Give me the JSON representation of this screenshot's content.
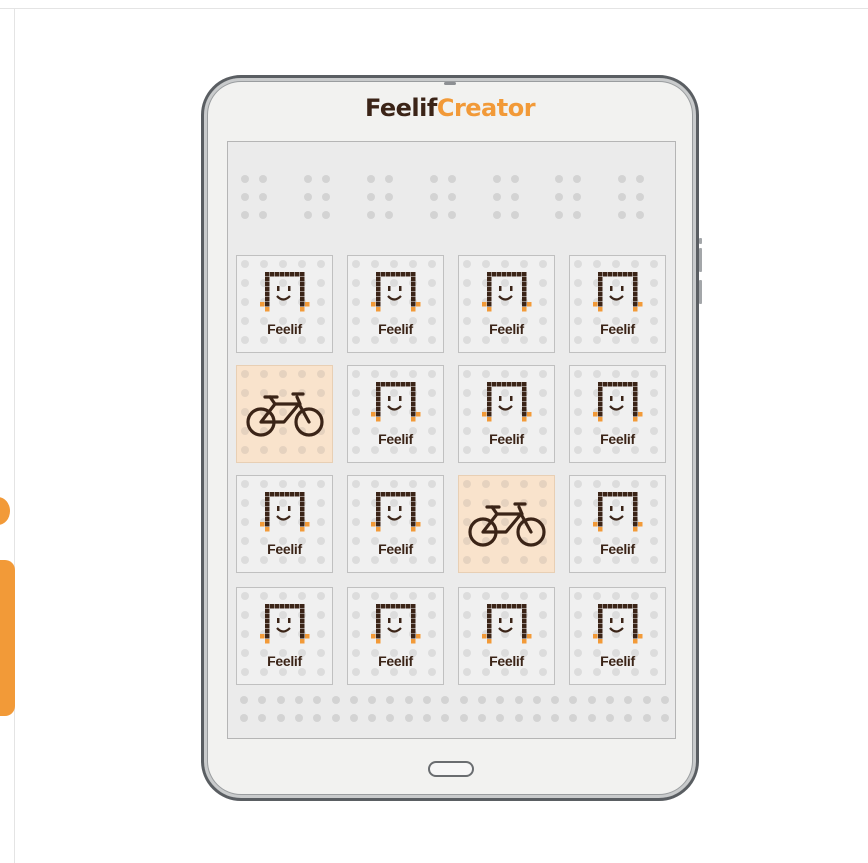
{
  "app": {
    "logo_part1": "Feelif",
    "logo_part2": "Creator"
  },
  "colors": {
    "brand_dark": "#3b2417",
    "brand_orange": "#f29a38",
    "highlight": "#f9e3cc"
  },
  "grid": {
    "rows": [
      [
        {
          "type": "feelif",
          "label": "Feelif",
          "icon": "feelif-face-icon",
          "highlighted": false
        },
        {
          "type": "feelif",
          "label": "Feelif",
          "icon": "feelif-face-icon",
          "highlighted": false
        },
        {
          "type": "feelif",
          "label": "Feelif",
          "icon": "feelif-face-icon",
          "highlighted": false
        },
        {
          "type": "feelif",
          "label": "Feelif",
          "icon": "feelif-face-icon",
          "highlighted": false
        }
      ],
      [
        {
          "type": "bicycle",
          "label": "",
          "icon": "bicycle-icon",
          "highlighted": true
        },
        {
          "type": "feelif",
          "label": "Feelif",
          "icon": "feelif-face-icon",
          "highlighted": false
        },
        {
          "type": "feelif",
          "label": "Feelif",
          "icon": "feelif-face-icon",
          "highlighted": false
        },
        {
          "type": "feelif",
          "label": "Feelif",
          "icon": "feelif-face-icon",
          "highlighted": false
        }
      ],
      [
        {
          "type": "feelif",
          "label": "Feelif",
          "icon": "feelif-face-icon",
          "highlighted": false
        },
        {
          "type": "feelif",
          "label": "Feelif",
          "icon": "feelif-face-icon",
          "highlighted": false
        },
        {
          "type": "bicycle",
          "label": "",
          "icon": "bicycle-icon",
          "highlighted": true
        },
        {
          "type": "feelif",
          "label": "Feelif",
          "icon": "feelif-face-icon",
          "highlighted": false
        }
      ],
      [
        {
          "type": "feelif",
          "label": "Feelif",
          "icon": "feelif-face-icon",
          "highlighted": false
        },
        {
          "type": "feelif",
          "label": "Feelif",
          "icon": "feelif-face-icon",
          "highlighted": false
        },
        {
          "type": "feelif",
          "label": "Feelif",
          "icon": "feelif-face-icon",
          "highlighted": false
        },
        {
          "type": "feelif",
          "label": "Feelif",
          "icon": "feelif-face-icon",
          "highlighted": false
        }
      ]
    ]
  }
}
